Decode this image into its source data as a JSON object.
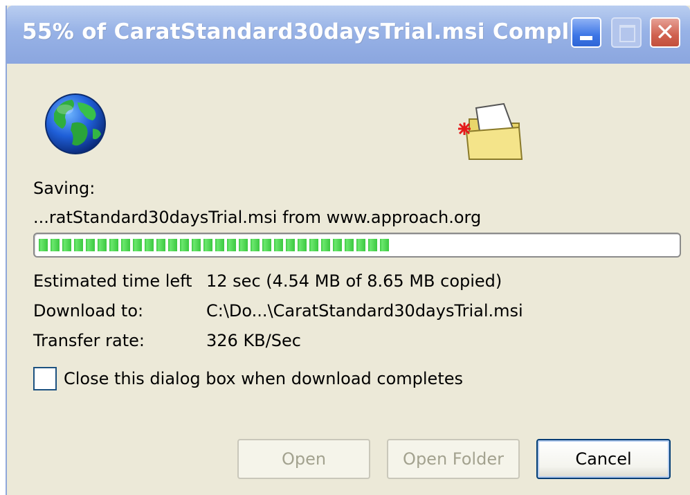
{
  "window": {
    "title": "55% of CaratStandard30daysTrial.msi Compl...",
    "controls": {
      "minimize_icon": "minimize-icon",
      "maximize_icon": "maximize-icon",
      "close_icon": "close-icon",
      "close_glyph": "✕"
    }
  },
  "icons": {
    "source": "globe-icon",
    "destination": "folder-icon"
  },
  "download": {
    "saving_label": "Saving:",
    "file_line": "...ratStandard30daysTrial.msi from www.approach.org",
    "progress_fraction": 0.55,
    "progress_color": "#3bc840",
    "details": [
      {
        "label": "Estimated time left",
        "value": "12 sec (4.54 MB of 8.65 MB copied)"
      },
      {
        "label": "Download to:",
        "value": "C:\\Do...\\CaratStandard30daysTrial.msi"
      },
      {
        "label": "Transfer rate:",
        "value": "326 KB/Sec"
      }
    ]
  },
  "options": {
    "close_on_complete_label": "Close this dialog box when download completes",
    "close_on_complete_checked": false
  },
  "buttons": {
    "open": "Open",
    "open_folder": "Open Folder",
    "cancel": "Cancel"
  }
}
